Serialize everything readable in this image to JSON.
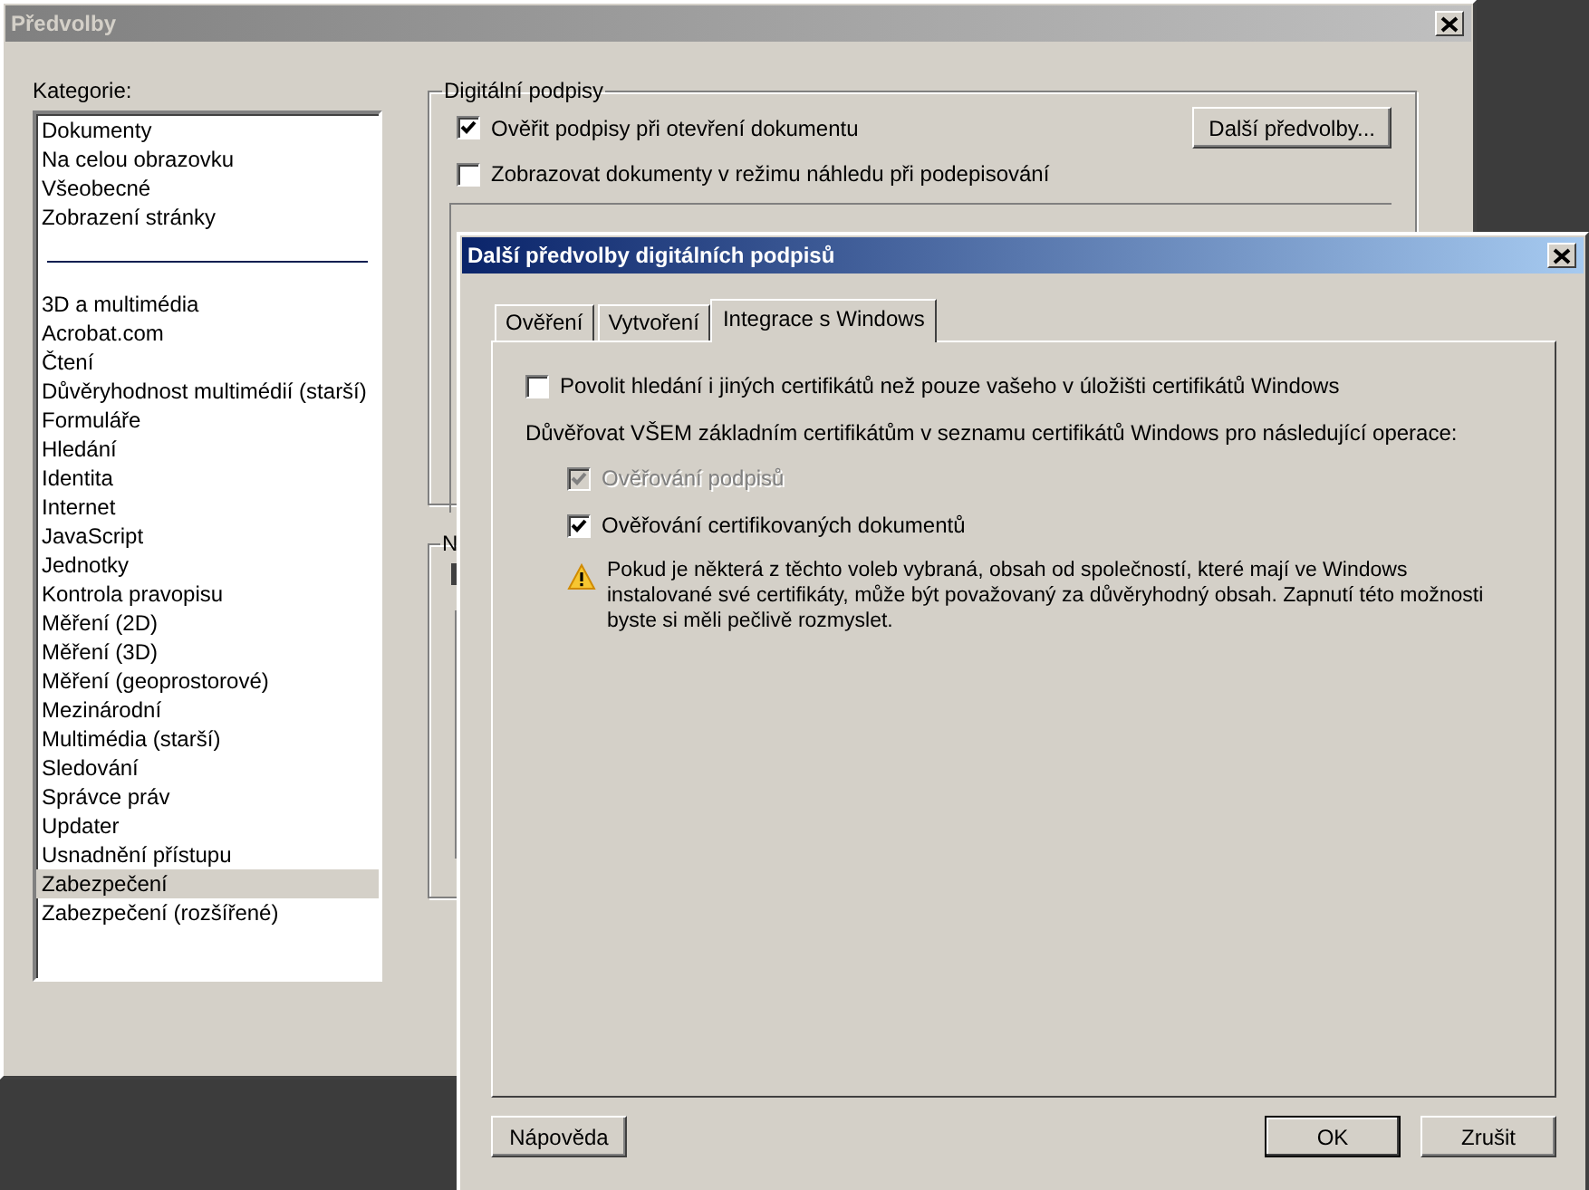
{
  "main_window": {
    "title": "Předvolby",
    "category_label": "Kategorie:",
    "categories": [
      {
        "kind": "item",
        "label": "Dokumenty",
        "selected": false
      },
      {
        "kind": "item",
        "label": "Na celou obrazovku",
        "selected": false
      },
      {
        "kind": "item",
        "label": "Všeobecné",
        "selected": false
      },
      {
        "kind": "item",
        "label": "Zobrazení stránky",
        "selected": false
      },
      {
        "kind": "separator"
      },
      {
        "kind": "item",
        "label": "3D a multimédia",
        "selected": false
      },
      {
        "kind": "item",
        "label": "Acrobat.com",
        "selected": false
      },
      {
        "kind": "item",
        "label": "Čtení",
        "selected": false
      },
      {
        "kind": "item",
        "label": "Důvěryhodnost multimédií (starší)",
        "selected": false
      },
      {
        "kind": "item",
        "label": "Formuláře",
        "selected": false
      },
      {
        "kind": "item",
        "label": "Hledání",
        "selected": false
      },
      {
        "kind": "item",
        "label": "Identita",
        "selected": false
      },
      {
        "kind": "item",
        "label": "Internet",
        "selected": false
      },
      {
        "kind": "item",
        "label": "JavaScript",
        "selected": false
      },
      {
        "kind": "item",
        "label": "Jednotky",
        "selected": false
      },
      {
        "kind": "item",
        "label": "Kontrola pravopisu",
        "selected": false
      },
      {
        "kind": "item",
        "label": "Měření (2D)",
        "selected": false
      },
      {
        "kind": "item",
        "label": "Měření (3D)",
        "selected": false
      },
      {
        "kind": "item",
        "label": "Měření (geoprostorové)",
        "selected": false
      },
      {
        "kind": "item",
        "label": "Mezinárodní",
        "selected": false
      },
      {
        "kind": "item",
        "label": "Multimédia (starší)",
        "selected": false
      },
      {
        "kind": "item",
        "label": "Sledování",
        "selected": false
      },
      {
        "kind": "item",
        "label": "Správce práv",
        "selected": false
      },
      {
        "kind": "item",
        "label": "Updater",
        "selected": false
      },
      {
        "kind": "item",
        "label": "Usnadnění přístupu",
        "selected": false
      },
      {
        "kind": "item",
        "label": "Zabezpečení",
        "selected": true
      },
      {
        "kind": "item",
        "label": "Zabezpečení (rozšířené)",
        "selected": false
      }
    ],
    "digital_signatures": {
      "title": "Digitální podpisy",
      "options": [
        {
          "label": "Ověřit podpisy při otevření dokumentu",
          "checked": true
        },
        {
          "label": "Zobrazovat dokumenty v režimu náhledu při podepisování",
          "checked": false
        }
      ],
      "more_button": "Další předvolby..."
    },
    "second_group": {
      "title": "N"
    }
  },
  "dialog": {
    "title": "Další předvolby digitálních podpisů",
    "tabs": [
      {
        "label": "Ověření",
        "selected": false
      },
      {
        "label": "Vytvoření",
        "selected": false
      },
      {
        "label": "Integrace s Windows",
        "selected": true
      }
    ],
    "search_option": {
      "label": "Povolit hledání i jiných certifikátů než pouze vašeho v úložišti certifikátů Windows",
      "checked": false
    },
    "trust_label": "Důvěřovat VŠEM základním certifikátům v seznamu certifikátů Windows pro následující operace:",
    "trust_options": [
      {
        "label": "Ověřování podpisů",
        "checked": true,
        "disabled": true
      },
      {
        "label": "Ověřování certifikovaných dokumentů",
        "checked": true,
        "disabled": false
      }
    ],
    "warning": "Pokud je některá z těchto voleb vybraná, obsah od společností, které mají ve Windows instalované své certifikáty, může být považovaný za důvěryhodný obsah. Zapnutí této možnosti byste si měli pečlivě rozmyslet.",
    "buttons": [
      {
        "label": "Nápověda",
        "default": false
      },
      {
        "label": "OK",
        "default": true
      },
      {
        "label": "Zrušit",
        "default": false
      }
    ]
  }
}
